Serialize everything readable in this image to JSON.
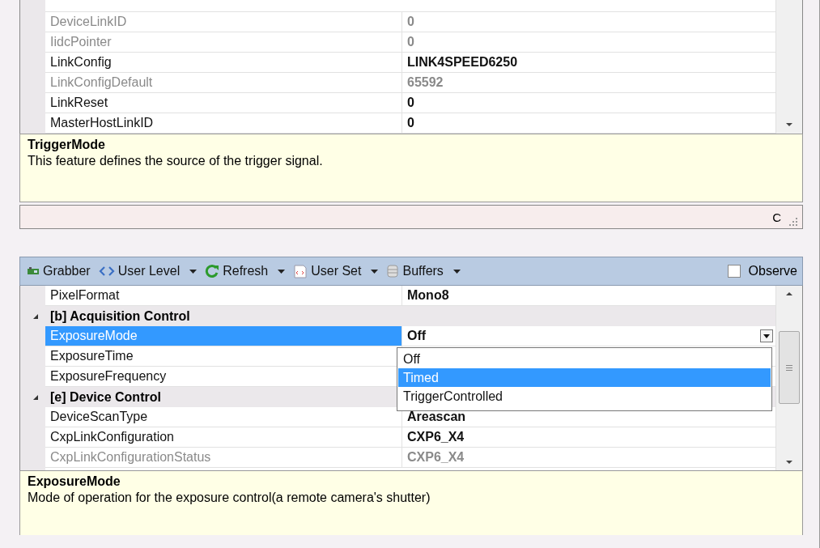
{
  "top_grid": {
    "rows": [
      {
        "kind": "property",
        "name": "DeviceLinkID",
        "value": "0",
        "disabled": true,
        "selected": false
      },
      {
        "kind": "property",
        "name": "IidcPointer",
        "value": "0",
        "disabled": true,
        "selected": false
      },
      {
        "kind": "property",
        "name": "LinkConfig",
        "value": "LINK4SPEED6250",
        "disabled": false,
        "selected": false
      },
      {
        "kind": "property",
        "name": "LinkConfigDefault",
        "value": "65592",
        "disabled": true,
        "selected": false
      },
      {
        "kind": "property",
        "name": "LinkReset",
        "value": "0",
        "disabled": false,
        "selected": false
      },
      {
        "kind": "property",
        "name": "MasterHostLinkID",
        "value": "0",
        "disabled": false,
        "selected": false
      }
    ]
  },
  "top_description": {
    "title": "TriggerMode",
    "text": "This feature defines the source of the trigger signal."
  },
  "status_bar": {
    "text": "C"
  },
  "toolbar": {
    "items": [
      {
        "label": "Grabber",
        "dropdown": false
      },
      {
        "label": "User Level",
        "dropdown": true
      },
      {
        "label": "Refresh",
        "dropdown": true
      },
      {
        "label": "User Set",
        "dropdown": true
      },
      {
        "label": "Buffers",
        "dropdown": true
      }
    ],
    "observe": {
      "label": "Observe",
      "checked": false
    }
  },
  "grid": {
    "rows": [
      {
        "kind": "property",
        "name": "PixelFormat",
        "value": "Mono8",
        "disabled": false,
        "selected": false
      },
      {
        "kind": "category",
        "name": "[b] Acquisition Control",
        "expanded": true
      },
      {
        "kind": "property",
        "name": "ExposureMode",
        "value": "Off",
        "disabled": false,
        "selected": true
      },
      {
        "kind": "property",
        "name": "ExposureTime",
        "disabled": false,
        "selected": false
      },
      {
        "kind": "property",
        "name": "ExposureFrequency",
        "disabled": false,
        "selected": false
      },
      {
        "kind": "category",
        "name": "[e] Device Control",
        "expanded": true
      },
      {
        "kind": "property",
        "name": "DeviceScanType",
        "value": "Areascan",
        "disabled": false,
        "selected": false
      },
      {
        "kind": "property",
        "name": "CxpLinkConfiguration",
        "value": "CXP6_X4",
        "disabled": false,
        "selected": false
      },
      {
        "kind": "property",
        "name": "CxpLinkConfigurationStatus",
        "value": "CXP6_X4",
        "disabled": true,
        "selected": false
      }
    ],
    "dropdown": {
      "options": [
        {
          "label": "Off",
          "selected": false
        },
        {
          "label": "Timed",
          "selected": true
        },
        {
          "label": "TriggerControlled",
          "selected": false
        }
      ]
    }
  },
  "description": {
    "title": "ExposureMode",
    "text": "Mode of operation for the exposure control(a remote camera's shutter)"
  }
}
